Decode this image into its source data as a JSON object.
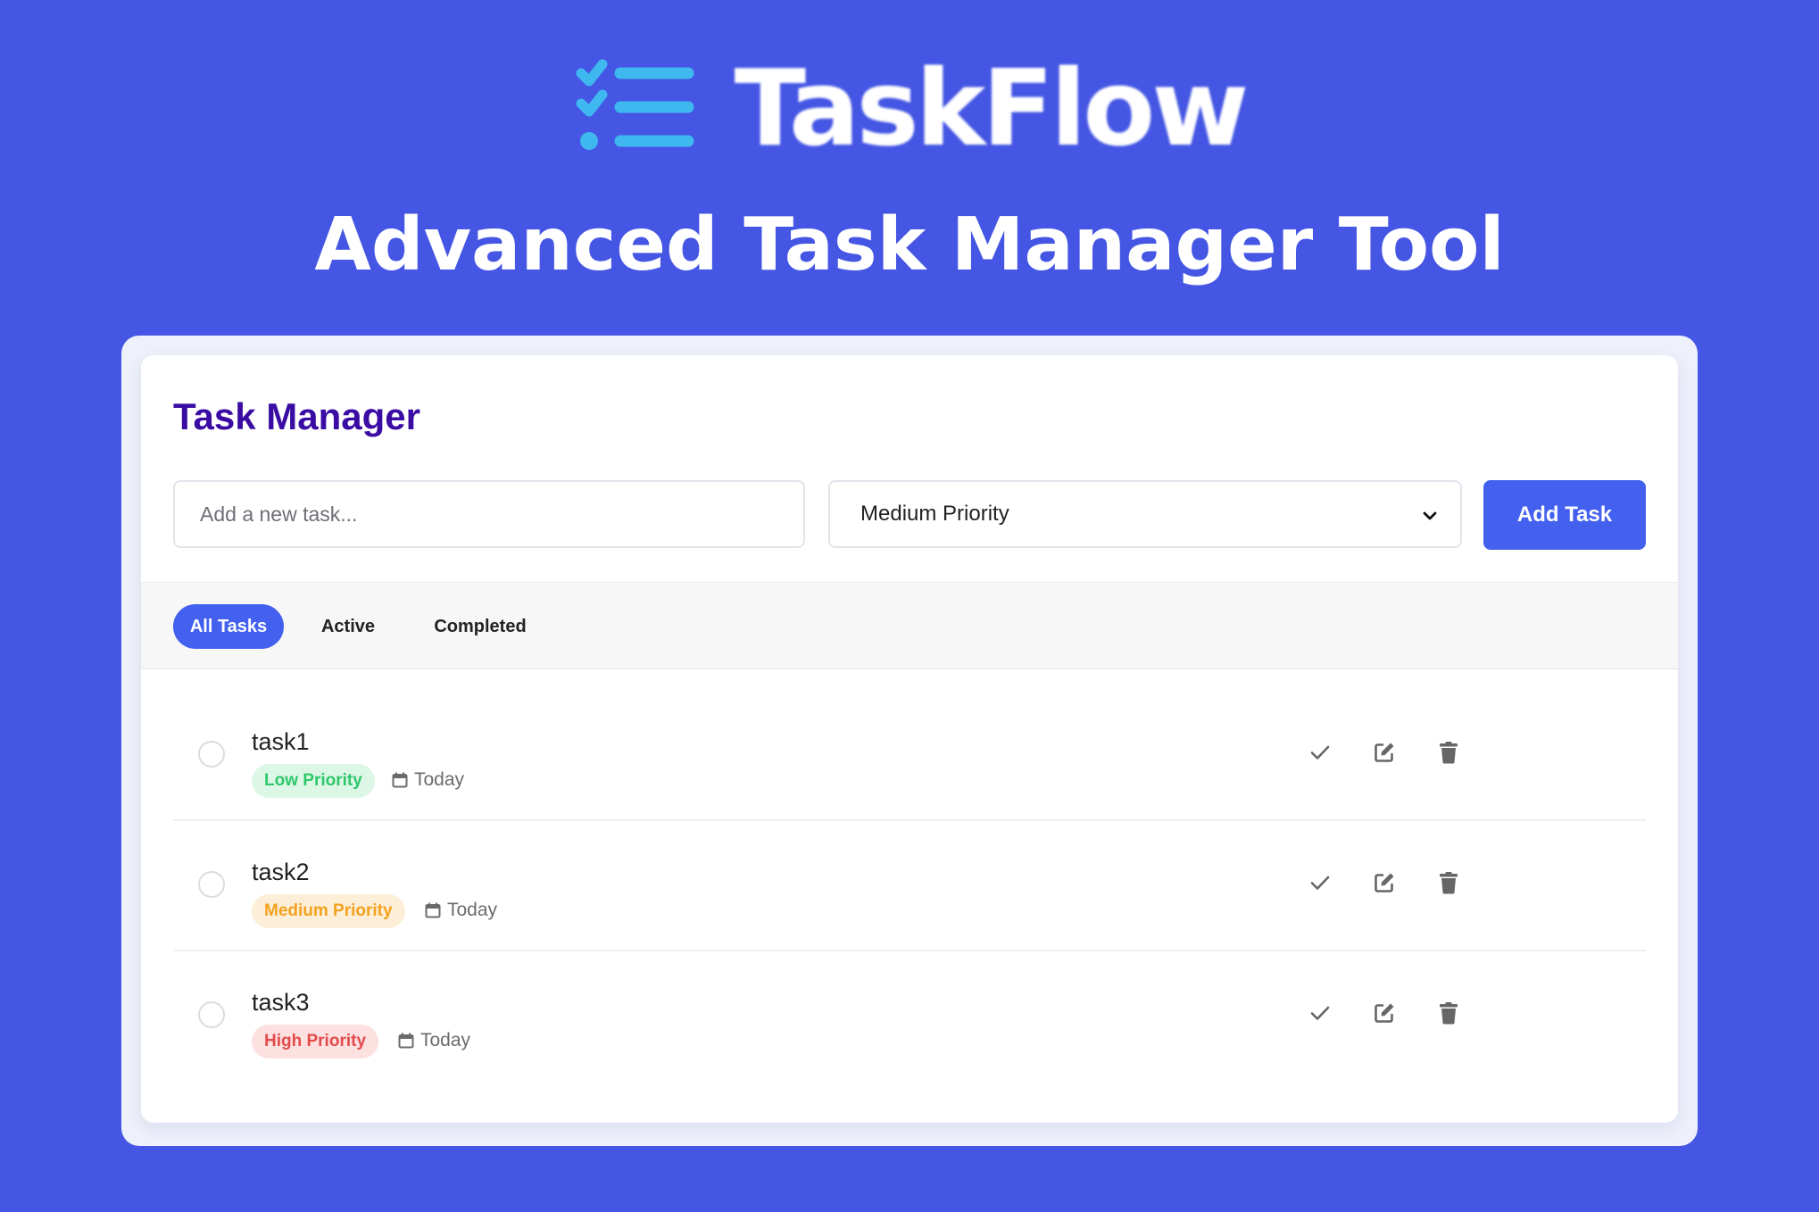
{
  "hero": {
    "brand": "TaskFlow",
    "subtitle": "Advanced Task Manager Tool",
    "logo_icon": "checklist-icon"
  },
  "app": {
    "title": "Task Manager",
    "new_task_placeholder": "Add a new task...",
    "new_task_value": "",
    "priority_selected": "Medium Priority",
    "add_button_label": "Add Task"
  },
  "filters": [
    {
      "label": "All Tasks",
      "active": true
    },
    {
      "label": "Active",
      "active": false
    },
    {
      "label": "Completed",
      "active": false
    }
  ],
  "tasks": [
    {
      "name": "task1",
      "priority": "Low Priority",
      "level": "low",
      "due": "Today",
      "completed": false
    },
    {
      "name": "task2",
      "priority": "Medium Priority",
      "level": "medium",
      "due": "Today",
      "completed": false
    },
    {
      "name": "task3",
      "priority": "High Priority",
      "level": "high",
      "due": "Today",
      "completed": false
    }
  ],
  "icons": {
    "complete": "check-icon",
    "edit": "edit-icon",
    "delete": "trash-icon",
    "due": "calendar-icon",
    "select": "chevron-down-icon"
  },
  "colors": {
    "background": "#4456e3",
    "accent": "#4361ee",
    "title": "#3a0ca3",
    "logo_cyan": "#3fb8f0",
    "low": "#2ec86a",
    "medium": "#f3a21e",
    "high": "#e24b4b"
  }
}
